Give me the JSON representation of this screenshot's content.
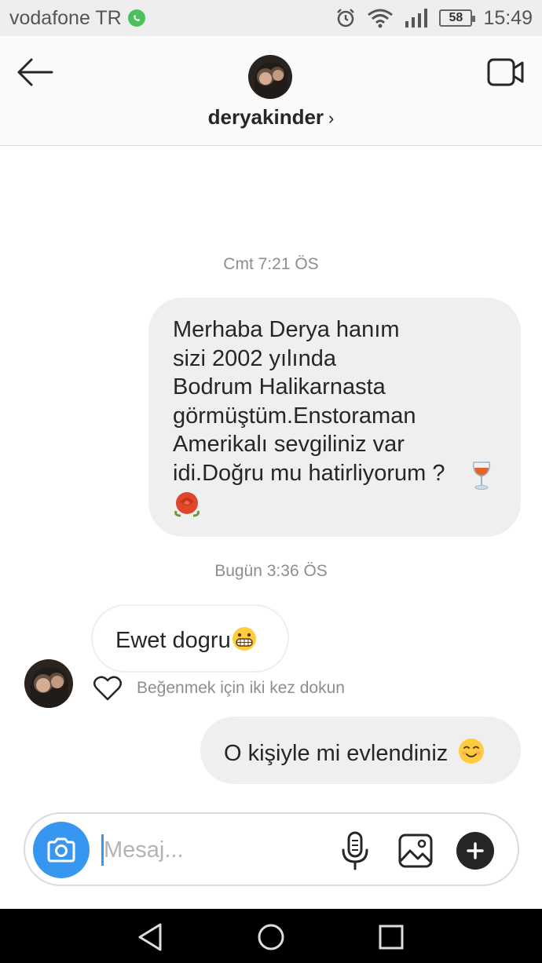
{
  "status_bar": {
    "carrier": "vodafone TR",
    "battery": "58",
    "time": "15:49"
  },
  "header": {
    "username": "deryakinder",
    "chevron": "›"
  },
  "messages": [
    {
      "timestamp": "Cmt 7:21 ÖS",
      "direction": "outgoing",
      "text": "Merhaba Derya hanım\nsizi 2002 yılında\nBodrum Halikarnasta\ngörmüştüm.Enstoraman\nAmerikalı sevgiliniz var\nidi.Doğru mu hatirliyorum ?",
      "emojis": [
        "wine-glass",
        "rose"
      ]
    },
    {
      "timestamp": "Bugün 3:36 ÖS",
      "direction": "incoming",
      "text": "Ewet dogru",
      "emojis": [
        "grinning-face"
      ],
      "like_hint": "Beğenmek için iki kez dokun"
    },
    {
      "direction": "outgoing",
      "text": "O kişiyle mi evlendiniz",
      "emojis": [
        "smiling-face"
      ]
    }
  ],
  "composer": {
    "placeholder": "Mesaj..."
  },
  "colors": {
    "accent": "#3797f0",
    "bubble_out": "#efefef",
    "text": "#262626",
    "muted": "#8e8e8e"
  }
}
